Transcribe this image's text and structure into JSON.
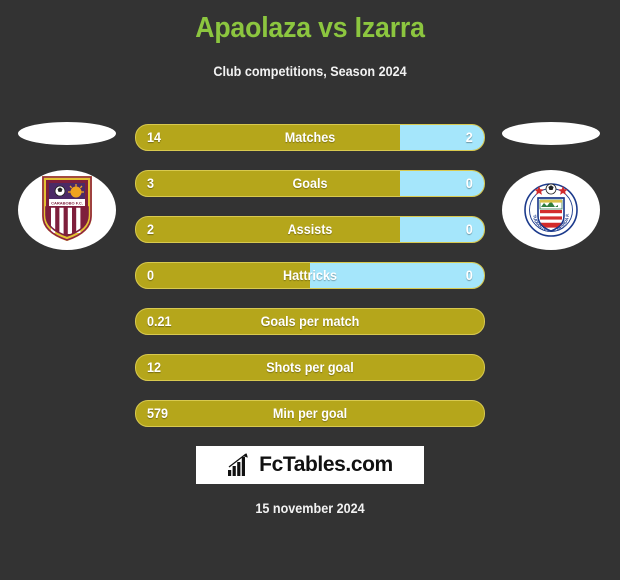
{
  "header": {
    "title": "Apaolaza vs Izarra",
    "subtitle": "Club competitions, Season 2024",
    "title_color": "#8CC63F"
  },
  "teams": {
    "home": {
      "crest_name": "carabobo-fc-crest",
      "crest_text": "CARABOBO F.C."
    },
    "away": {
      "crest_name": "estudiantes-de-merida-fc-crest",
      "crest_text": "ESTUDIANTES DE MERIDA F.C."
    }
  },
  "colors": {
    "background": "#333333",
    "home_bar": "#B5A61B",
    "away_bar": "#A5E6FB",
    "accent_green": "#8CC63F"
  },
  "chart_data": {
    "type": "bar",
    "title": "Apaolaza vs Izarra",
    "subtitle": "Club competitions, Season 2024",
    "categories": [
      "Matches",
      "Goals",
      "Assists",
      "Hattricks",
      "Goals per match",
      "Shots per goal",
      "Min per goal"
    ],
    "series": [
      {
        "name": "Apaolaza",
        "values": [
          "14",
          "3",
          "2",
          "0",
          "0.21",
          "12",
          "579"
        ]
      },
      {
        "name": "Izarra",
        "values": [
          "2",
          "0",
          "0",
          "0",
          null,
          null,
          null
        ]
      }
    ],
    "legend": "none",
    "grid": false,
    "orientation": "horizontal-split"
  },
  "rows": [
    {
      "label": "Matches",
      "home": "14",
      "away": "2",
      "home_pct": 76,
      "two_sided": true
    },
    {
      "label": "Goals",
      "home": "3",
      "away": "0",
      "home_pct": 76,
      "two_sided": true
    },
    {
      "label": "Assists",
      "home": "2",
      "away": "0",
      "home_pct": 76,
      "two_sided": true
    },
    {
      "label": "Hattricks",
      "home": "0",
      "away": "0",
      "home_pct": 50,
      "two_sided": true
    },
    {
      "label": "Goals per match",
      "home": "0.21",
      "away": "",
      "home_pct": 100,
      "two_sided": false
    },
    {
      "label": "Shots per goal",
      "home": "12",
      "away": "",
      "home_pct": 100,
      "two_sided": false
    },
    {
      "label": "Min per goal",
      "home": "579",
      "away": "",
      "home_pct": 100,
      "two_sided": false
    }
  ],
  "footer": {
    "brand": "FcTables.com",
    "brand_icon": "bar-chart-growth-icon",
    "date": "15 november 2024"
  }
}
